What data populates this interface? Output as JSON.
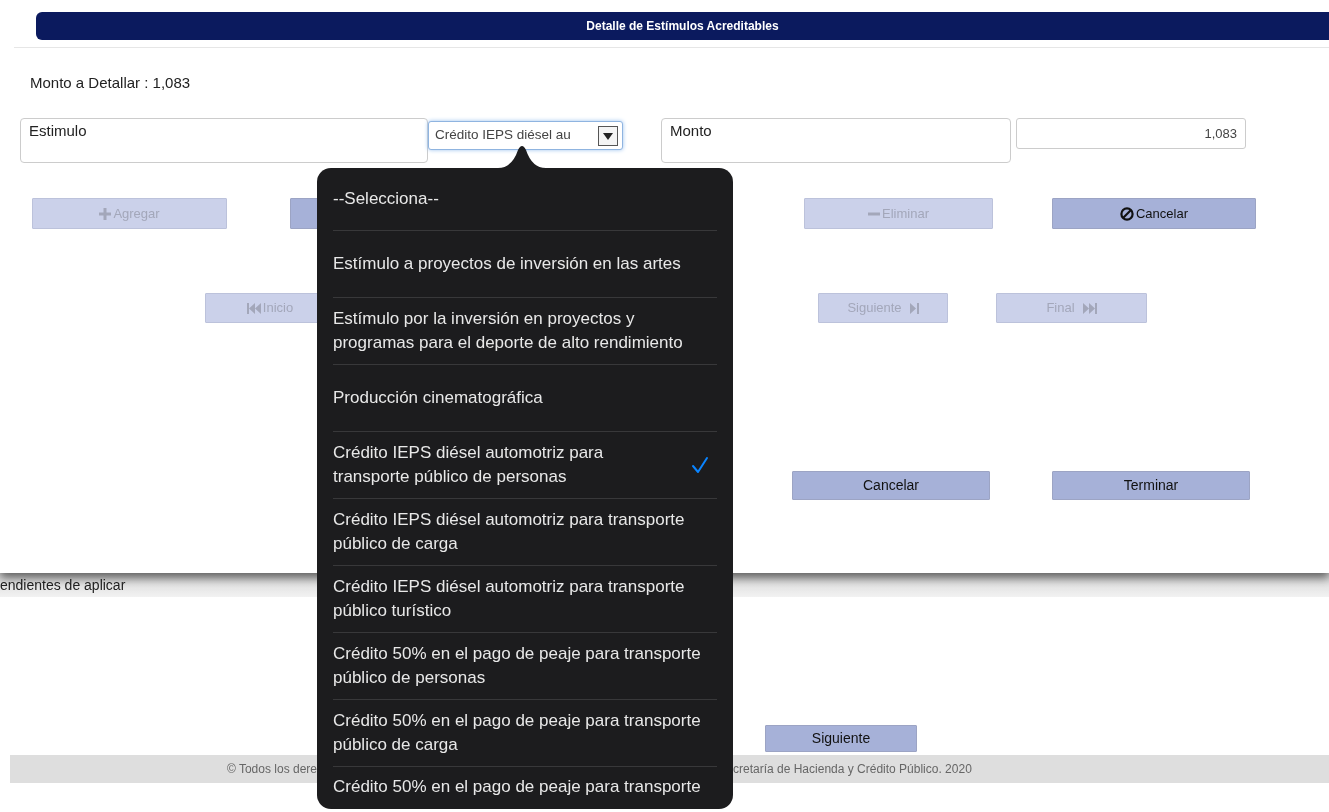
{
  "dialog": {
    "title": "Detalle de Estímulos Acreditables",
    "amount_label": "Monto a Detallar : 1,083",
    "fields": [
      {
        "label": "Estimulo",
        "kind": "select",
        "value": "Crédito IEPS diésel au"
      },
      {
        "label": "Monto",
        "kind": "text",
        "value": "1,083"
      }
    ],
    "action_buttons": [
      {
        "kind": "add",
        "label": "Agregar",
        "disabled": true
      },
      {
        "kind": "stub",
        "disabled": false
      },
      {
        "kind": "delete",
        "label": "Eliminar",
        "disabled": true
      },
      {
        "kind": "cancel",
        "label": "Cancelar",
        "disabled": false
      }
    ],
    "nav_buttons": [
      {
        "kind": "first",
        "label": "Inicio",
        "disabled": true
      },
      {
        "kind": "next",
        "label": "Siguiente",
        "disabled": true
      },
      {
        "kind": "last",
        "label": "Final",
        "disabled": true
      }
    ],
    "footer_buttons": [
      {
        "label": "Cancelar",
        "disabled": false
      },
      {
        "label": "Terminar",
        "disabled": false
      }
    ]
  },
  "background": {
    "section_label": "endientes de aplicar",
    "button": {
      "label": "Siguiente",
      "disabled": false
    },
    "footer": [
      "© Todos los dere",
      "cretaría de Hacienda y Crédito Público. 2020"
    ]
  },
  "dropdown": {
    "options": [
      {
        "label": "--Selecciona--",
        "selected": false
      },
      {
        "label": "Estímulo a proyectos de inversión en las artes",
        "selected": false
      },
      {
        "label": "Estímulo por la inversión en proyectos y programas para el deporte de alto rendimiento",
        "selected": false
      },
      {
        "label": "Producción cinematográfica",
        "selected": false
      },
      {
        "label": "Crédito IEPS diésel automotriz para transporte público de personas",
        "selected": true
      },
      {
        "label": "Crédito IEPS diésel automotriz para transporte público de carga",
        "selected": false
      },
      {
        "label": "Crédito IEPS diésel automotriz para transporte público turístico",
        "selected": false
      },
      {
        "label": "Crédito 50% en el pago de peaje para transporte público de personas",
        "selected": false
      },
      {
        "label": "Crédito 50% en el pago de peaje para transporte público de carga",
        "selected": false
      },
      {
        "label": "Crédito 50% en el pago de peaje para transporte",
        "selected": false
      }
    ]
  }
}
